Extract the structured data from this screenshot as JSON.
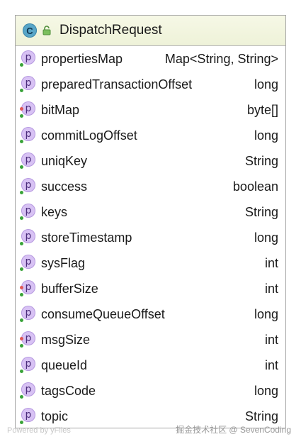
{
  "class": {
    "icon_letter": "C",
    "title": "DispatchRequest",
    "accent": "#58a6c8"
  },
  "fields": [
    {
      "name": "propertiesMap",
      "type": "Map<String, String>",
      "marker": "green"
    },
    {
      "name": "preparedTransactionOffset",
      "type": "long",
      "marker": "green"
    },
    {
      "name": "bitMap",
      "type": "byte[]",
      "marker": "red-green"
    },
    {
      "name": "commitLogOffset",
      "type": "long",
      "marker": "green"
    },
    {
      "name": "uniqKey",
      "type": "String",
      "marker": "green"
    },
    {
      "name": "success",
      "type": "boolean",
      "marker": "green"
    },
    {
      "name": "keys",
      "type": "String",
      "marker": "green"
    },
    {
      "name": "storeTimestamp",
      "type": "long",
      "marker": "green"
    },
    {
      "name": "sysFlag",
      "type": "int",
      "marker": "green"
    },
    {
      "name": "bufferSize",
      "type": "int",
      "marker": "red-green"
    },
    {
      "name": "consumeQueueOffset",
      "type": "long",
      "marker": "green"
    },
    {
      "name": "msgSize",
      "type": "int",
      "marker": "red-green"
    },
    {
      "name": "queueId",
      "type": "int",
      "marker": "green"
    },
    {
      "name": "tagsCode",
      "type": "long",
      "marker": "green"
    },
    {
      "name": "topic",
      "type": "String",
      "marker": "green"
    }
  ],
  "field_icon_letter": "p",
  "footer": {
    "left": "Powered by yFiles",
    "right": "掘金技术社区 @ SevenCoding"
  }
}
